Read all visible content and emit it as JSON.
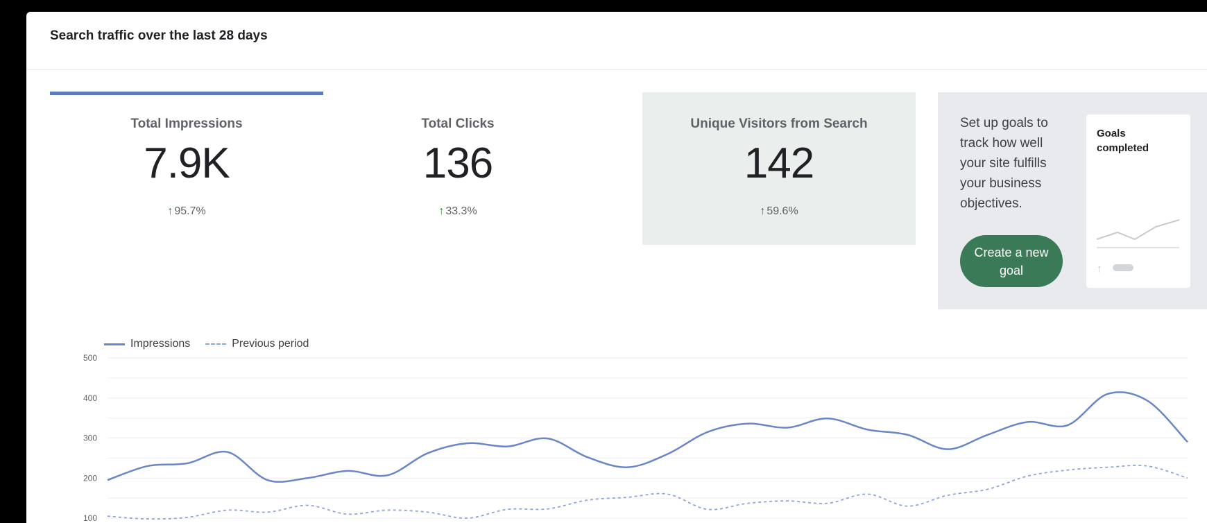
{
  "card": {
    "title": "Search traffic over the last 28 days"
  },
  "metrics": [
    {
      "label": "Total Impressions",
      "value": "7.9K",
      "delta": "95.7%",
      "arrow": "↑",
      "selected": true
    },
    {
      "label": "Total Clicks",
      "value": "136",
      "delta": "33.3%",
      "arrow": "↑",
      "selected": false
    },
    {
      "label": "Unique Visitors from Search",
      "value": "142",
      "delta": "59.6%",
      "arrow": "↑",
      "selected": false
    }
  ],
  "goals": {
    "text": "Set up goals to track how well your site fulfills your business objectives.",
    "button_label": "Create a new goal",
    "mini_card_title": "Goals completed"
  },
  "colors": {
    "accent": "#5b7bbd",
    "series_current": "#6b86c6",
    "series_previous": "#8ea3d6",
    "positive": "#2e7d32",
    "goal_button": "#3b7a57"
  },
  "chart_data": {
    "type": "line",
    "ylim": [
      0,
      500
    ],
    "yticks": [
      100,
      200,
      300,
      400,
      500
    ],
    "grid": true,
    "legend_position": "top-left",
    "series": [
      {
        "name": "Impressions",
        "style": "solid",
        "values": [
          195,
          230,
          237,
          265,
          195,
          200,
          218,
          207,
          262,
          287,
          279,
          299,
          252,
          227,
          260,
          315,
          336,
          326,
          349,
          321,
          308,
          272,
          308,
          340,
          332,
          410,
          393,
          290
        ]
      },
      {
        "name": "Previous period",
        "style": "dashed",
        "values": [
          105,
          98,
          102,
          120,
          115,
          132,
          110,
          120,
          115,
          100,
          122,
          123,
          145,
          152,
          160,
          122,
          137,
          143,
          137,
          160,
          130,
          157,
          172,
          205,
          220,
          227,
          230,
          200
        ]
      }
    ]
  }
}
